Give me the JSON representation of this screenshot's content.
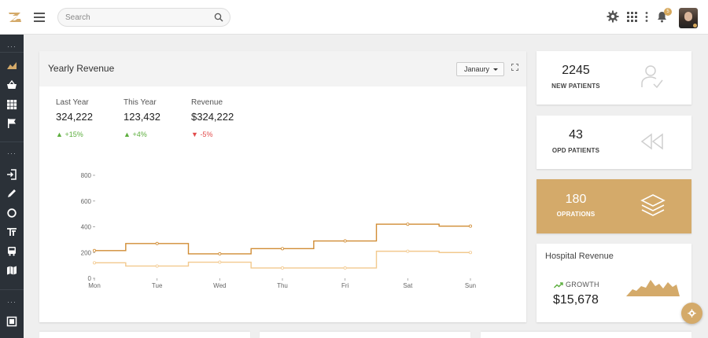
{
  "header": {
    "search_placeholder": "Search",
    "notification_count": "5"
  },
  "revenue": {
    "title": "Yearly Revenue",
    "month_select": "Janaury",
    "stats": [
      {
        "label": "Last Year",
        "value": "324,222",
        "change": "+15%",
        "trend": "up"
      },
      {
        "label": "This Year",
        "value": "123,432",
        "change": "+4%",
        "trend": "up"
      },
      {
        "label": "Revenue",
        "value": "$324,222",
        "change": "-5%",
        "trend": "down"
      }
    ]
  },
  "chart_data": {
    "type": "line",
    "categories": [
      "Mon",
      "Tue",
      "Wed",
      "Thu",
      "Fri",
      "Sat",
      "Sun"
    ],
    "y_ticks": [
      "0",
      "200",
      "400",
      "600",
      "800"
    ],
    "ylim": [
      0,
      800
    ],
    "step": true,
    "series": [
      {
        "color": "#d08c34",
        "values": [
          215,
          270,
          190,
          230,
          290,
          420,
          405
        ]
      },
      {
        "color": "#f2c98e",
        "values": [
          120,
          95,
          125,
          80,
          80,
          210,
          200
        ]
      }
    ]
  },
  "stat_cards": [
    {
      "number": "2245",
      "caption": "NEW PATIENTS",
      "icon": "user-check-icon"
    },
    {
      "number": "43",
      "caption": "OPD PATIENTS",
      "icon": "rewind-icon"
    },
    {
      "number": "180",
      "caption": "OPRATIONS",
      "icon": "layers-icon"
    }
  ],
  "hospital": {
    "title": "Hospital Revenue",
    "growth_label": "GROWTH",
    "value": "$15,678"
  },
  "colors": {
    "accent": "#d4aa6a",
    "sidebar": "#2b3138",
    "up": "#5cae3d",
    "down": "#e24c4c"
  }
}
